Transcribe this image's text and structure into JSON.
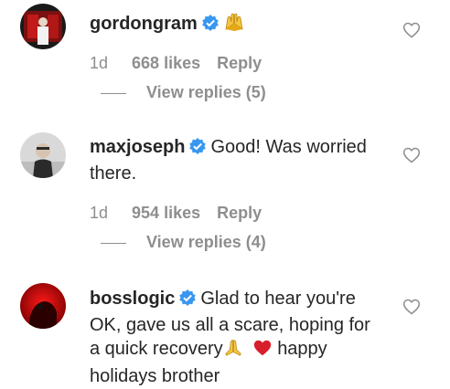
{
  "comments": [
    {
      "username": "gordongram",
      "text": "",
      "time": "1d",
      "likes": "668 likes",
      "reply_label": "Reply",
      "view_replies": "View replies (5)",
      "emoji": "raised-hands-icon"
    },
    {
      "username": "maxjoseph",
      "text_line1": "Good! Was worried",
      "text_line2": "there.",
      "time": "1d",
      "likes": "954 likes",
      "reply_label": "Reply",
      "view_replies": "View replies (4)"
    },
    {
      "username": "bosslogic",
      "text_line1": "Glad to hear you're",
      "text_line2": "OK, gave us all a scare, hoping for",
      "text_line3": "a quick recovery",
      "text_line3b": "happy",
      "text_line4": "holidays brother"
    }
  ],
  "colors": {
    "text": "#262626",
    "muted": "#8e8e8e",
    "verified": "#3897f0",
    "heart_red": "#ed4956"
  }
}
